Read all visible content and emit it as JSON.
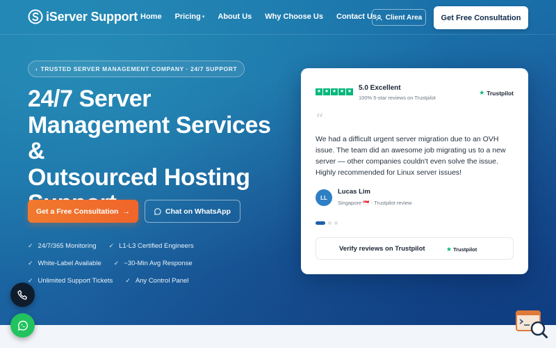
{
  "nav": {
    "logo_text": "iServer Support",
    "links": [
      {
        "label": "Home"
      },
      {
        "label": "Pricing",
        "dropdown": true
      },
      {
        "label": "About Us"
      },
      {
        "label": "Why Choose Us"
      },
      {
        "label": "Contact Us"
      }
    ],
    "client_area": "Client Area",
    "cta": "Get Free Consultation"
  },
  "hero": {
    "badge": "TRUSTED SERVER MANAGEMENT COMPANY · 24/7 SUPPORT",
    "title_lines": [
      "24/7 Server",
      "Management Services &",
      "Outsourced Hosting",
      "Support"
    ],
    "cta_primary": "Get a Free Consultation",
    "cta_secondary": "Chat on WhatsApp",
    "features": [
      [
        "24/7/365 Monitoring",
        "L1-L3 Certified Engineers"
      ],
      [
        "White-Label Available",
        "~30-Min Avg Response"
      ],
      [
        "Unlimited Support Tickets",
        "Any Control Panel"
      ]
    ]
  },
  "review_card": {
    "rating_title": "5.0 Excellent",
    "rating_sub": "100% 5-star reviews on Trustpilot",
    "trustpilot_label": "Trustpilot",
    "quote_mark": "“",
    "review_text": "We had a difficult urgent server migration due to an OVH issue. The team did an awesome job migrating us to a new server — other companies couldn't even solve the issue. Highly recommended for Linux server issues!",
    "reviewer_initials": "LL",
    "reviewer_name": "Lucas Lim",
    "reviewer_meta": "Singapore 🇸🇬 · Trustpilot review",
    "active_slide": 0,
    "slide_count": 3,
    "verify_label": "Verify reviews on Trustpilot",
    "verify_brand": "Trustpilot"
  },
  "colors": {
    "accent_orange": "#f0652a",
    "trustpilot_green": "#00b67a",
    "whatsapp_green": "#22c35e",
    "primary_blue": "#1f5fa8"
  },
  "icons": {
    "logo": "logo-s-icon",
    "user": "user-icon",
    "arrow": "arrow-right-icon",
    "whatsapp": "whatsapp-icon",
    "check": "check-icon",
    "star": "star-icon",
    "phone": "phone-icon",
    "search": "search-widget-icon"
  }
}
